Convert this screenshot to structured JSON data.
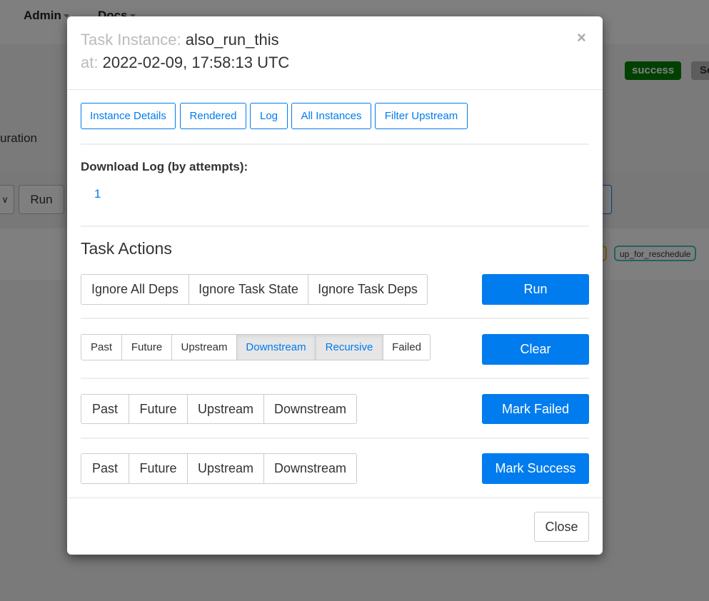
{
  "navbar": {
    "admin_label": "Admin",
    "docs_label": "Docs"
  },
  "background": {
    "duration_label": "uration",
    "run_label": "Run",
    "state_badge": "success",
    "state_badge_2": "Se",
    "reschedule_chip": "up_for_reschedule"
  },
  "modal": {
    "title_prefix": "Task Instance:",
    "task_id": "also_run_this",
    "at_prefix": "at:",
    "execution_date": "2022-02-09, 17:58:13 UTC",
    "close_symbol": "×",
    "tabs": [
      "Instance Details",
      "Rendered",
      "Log",
      "All Instances",
      "Filter Upstream"
    ],
    "download_log_label": "Download Log (by attempts):",
    "download_attempts": [
      "1"
    ],
    "task_actions_title": "Task Actions",
    "run": {
      "options": [
        "Ignore All Deps",
        "Ignore Task State",
        "Ignore Task Deps"
      ],
      "button": "Run"
    },
    "clear": {
      "options": [
        "Past",
        "Future",
        "Upstream",
        "Downstream",
        "Recursive",
        "Failed"
      ],
      "active": [
        "Downstream",
        "Recursive"
      ],
      "button": "Clear"
    },
    "mark_failed": {
      "options": [
        "Past",
        "Future",
        "Upstream",
        "Downstream"
      ],
      "button": "Mark Failed"
    },
    "mark_success": {
      "options": [
        "Past",
        "Future",
        "Upstream",
        "Downstream"
      ],
      "button": "Mark Success"
    },
    "close_button": "Close"
  },
  "colors": {
    "primary": "#017cee",
    "success_badge": "#008000",
    "overlay": "rgba(0,0,0,0.5)"
  }
}
